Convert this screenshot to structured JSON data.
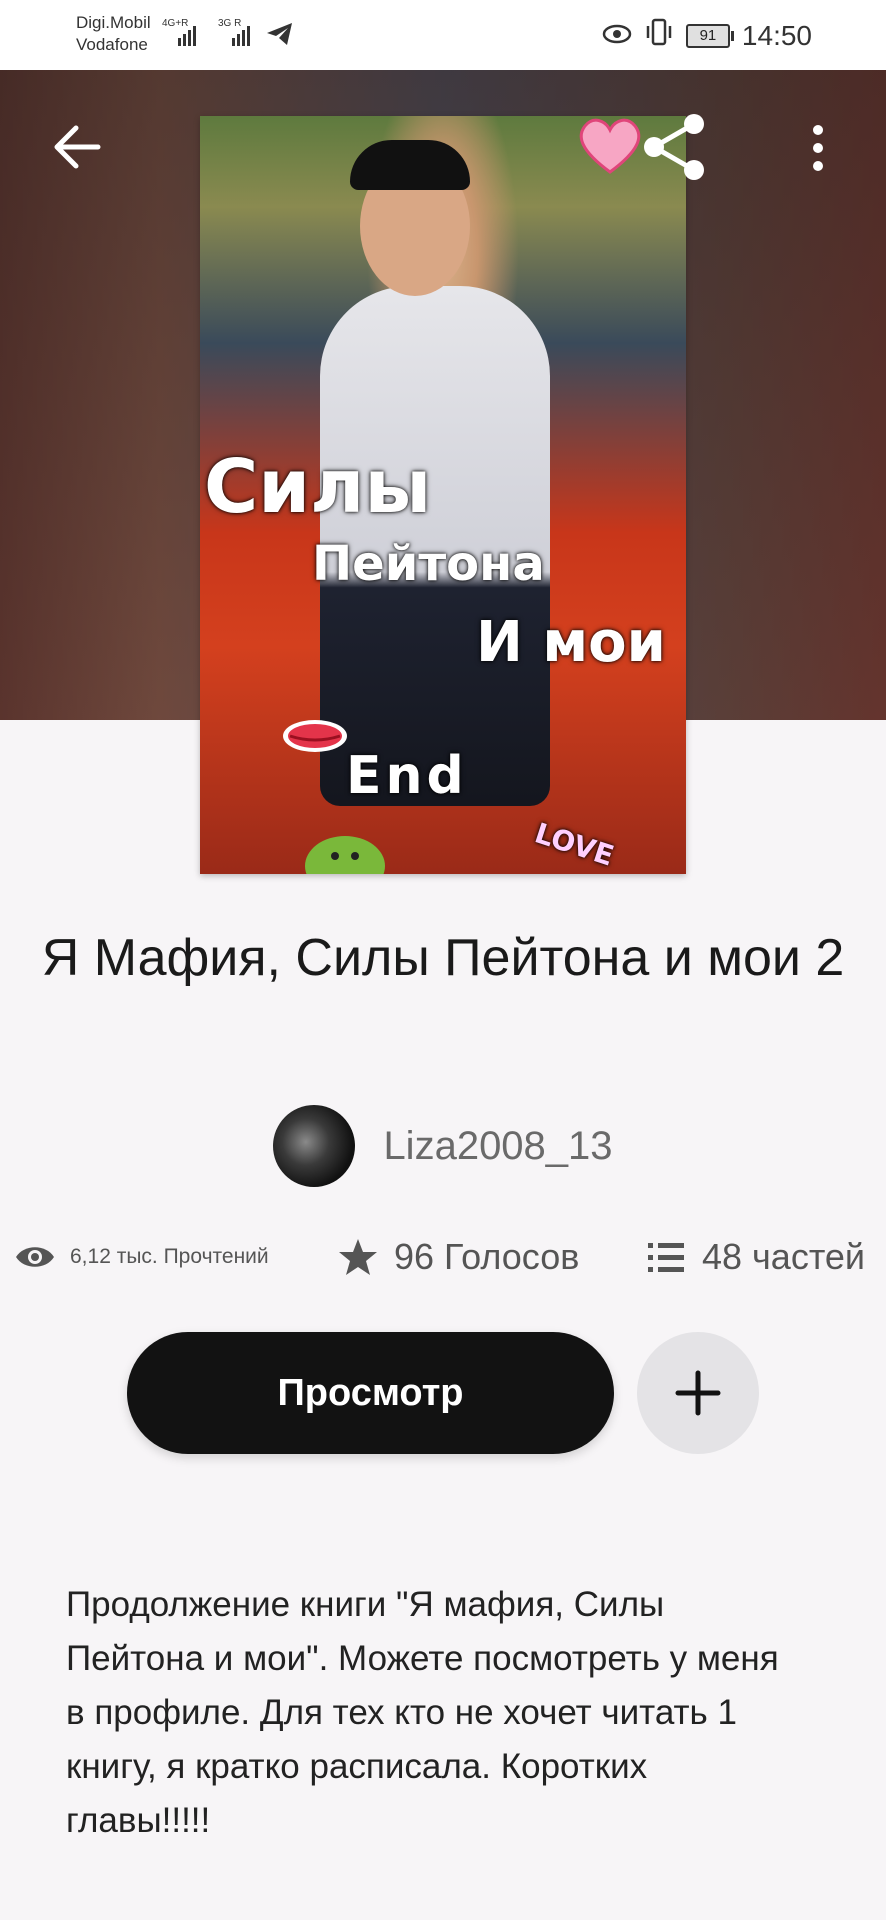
{
  "status_bar": {
    "carrier_line1": "Digi.Mobil",
    "carrier_line2": "Vodafone",
    "net1": "4G+R",
    "net2": "3G R",
    "battery": "91",
    "time": "14:50"
  },
  "cover": {
    "line1": "Силы",
    "line2": "Пейтона",
    "line3": "И мои",
    "line4": "End",
    "sticker": "LOVE"
  },
  "story": {
    "title": "Я Мафия, Силы Пейтона и мои 2",
    "author": "Liza2008_13",
    "reads": "6,12 тыс. Прочтений",
    "votes": "96 Голосов",
    "parts": "48 частей",
    "read_button": "Просмотр",
    "description": "Продолжение книги \"Я мафия, Силы Пейтона и мои\". Можете посмотреть у меня в профиле. Для тех кто не хочет читать 1 книгу, я кратко расписала. Коротких главы!!!!!"
  },
  "icons": {
    "back": "arrow-left-icon",
    "share": "share-icon",
    "more": "more-vertical-icon",
    "reads": "eye-icon",
    "votes": "star-icon",
    "parts": "list-icon",
    "add": "plus-icon"
  }
}
